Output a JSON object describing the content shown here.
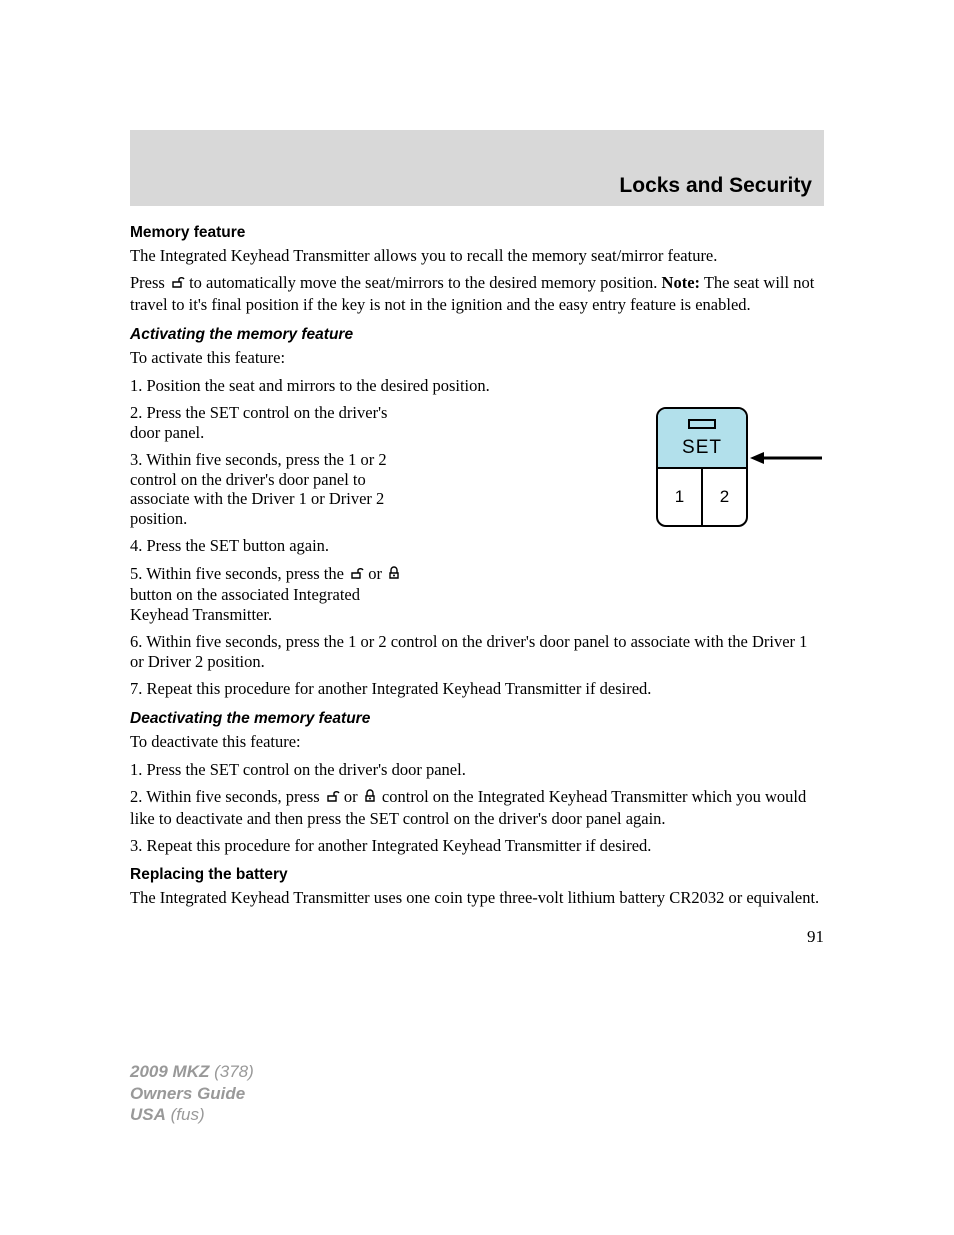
{
  "header": {
    "title": "Locks and Security"
  },
  "section_memory": {
    "heading": "Memory feature",
    "p1": "The Integrated Keyhead Transmitter allows you to recall the memory seat/mirror feature.",
    "p2a": "Press ",
    "p2b": " to automatically move the seat/mirrors to the desired memory position. ",
    "p2_note_label": "Note:",
    "p2c": " The seat will not travel to it's final position if the key is not in the ignition and the easy entry feature is enabled."
  },
  "section_activating": {
    "heading": "Activating the memory feature",
    "intro": "To activate this feature:",
    "s1": "1. Position the seat and mirrors to the desired position.",
    "s2": "2. Press the SET control on the driver's door panel.",
    "s3": "3. Within five seconds, press the 1 or 2 control on the driver's door panel to associate with the Driver 1 or Driver 2 position.",
    "s4": "4. Press the SET button again.",
    "s5a": "5. Within five seconds, press the ",
    "s5b": " or ",
    "s5c": " button on the associated Integrated Keyhead Transmitter.",
    "s6": "6. Within five seconds, press the 1 or 2 control on the driver's door panel to associate with the Driver 1 or Driver 2 position.",
    "s7": "7. Repeat this procedure for another Integrated Keyhead Transmitter if desired."
  },
  "section_deactivating": {
    "heading": "Deactivating the memory feature",
    "intro": "To deactivate this feature:",
    "s1": "1. Press the SET control on the driver's door panel.",
    "s2a": "2. Within five seconds, press ",
    "s2b": " or ",
    "s2c": " control on the Integrated Keyhead Transmitter which you would like to deactivate and then press the SET control on the driver's door panel again.",
    "s3": "3. Repeat this procedure for another Integrated Keyhead Transmitter if desired."
  },
  "section_battery": {
    "heading": "Replacing the battery",
    "p1": "The Integrated Keyhead Transmitter uses one coin type three-volt lithium battery CR2032 or equivalent."
  },
  "set_panel": {
    "label": "SET",
    "btn1": "1",
    "btn2": "2"
  },
  "page_number": "91",
  "footer": {
    "l1a": "2009 MKZ",
    "l1b": " (378)",
    "l2": "Owners Guide",
    "l3a": "USA",
    "l3b": " (fus)"
  }
}
